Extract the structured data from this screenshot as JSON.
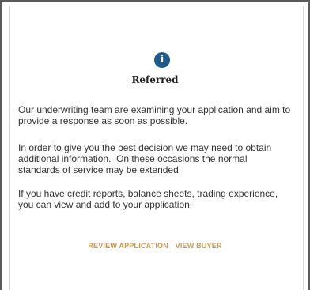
{
  "dialog": {
    "icon": "info-icon",
    "icon_glyph": "i",
    "title": "Referred",
    "paragraphs": [
      "Our underwriting team are examining your application and aim to provide a response as soon as possible.",
      "In order to give you the best decision we may need to obtain additional information.  On these occasions the normal standards of service may be extended",
      "If you have credit reports, balance sheets, trading experience, you can view and add to your application."
    ],
    "actions": {
      "review_label": "REVIEW APPLICATION",
      "view_buyer_label": "VIEW BUYER"
    }
  },
  "colors": {
    "icon_background": "#1e5a8c",
    "link": "#c49a53",
    "text": "#333333",
    "frame": "#5a5a5a"
  }
}
